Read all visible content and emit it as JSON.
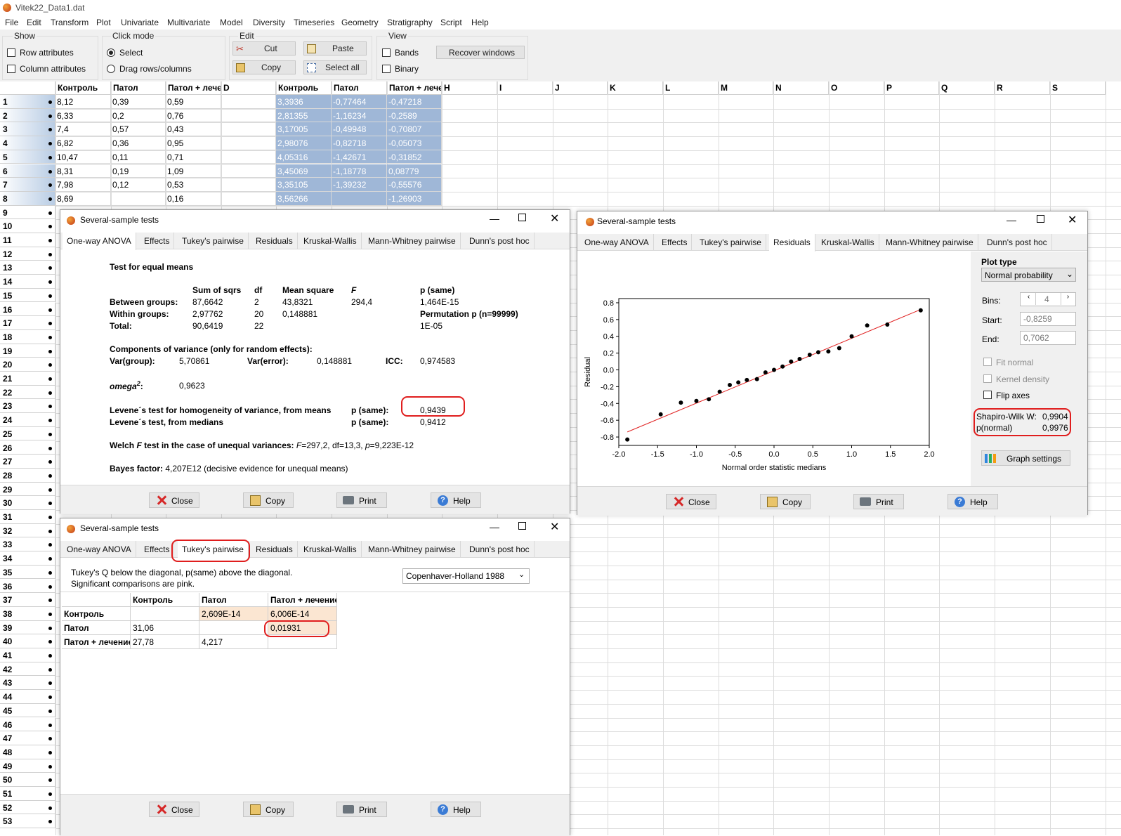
{
  "window_title": "Vitek22_Data1.dat",
  "menu": [
    "File",
    "Edit",
    "Transform",
    "Plot",
    "Univariate",
    "Multivariate",
    "Model",
    "Diversity",
    "Timeseries",
    "Geometry",
    "Stratigraphy",
    "Script",
    "Help"
  ],
  "toolbar": {
    "show_label": "Show",
    "row_attributes": "Row attributes",
    "column_attributes": "Column attributes",
    "click_mode_label": "Click mode",
    "select": "Select",
    "drag": "Drag rows/columns",
    "edit_label": "Edit",
    "cut": "Cut",
    "copy": "Copy",
    "paste": "Paste",
    "select_all": "Select all",
    "view_label": "View",
    "bands": "Bands",
    "binary": "Binary",
    "recover": "Recover windows"
  },
  "sheet": {
    "columns": [
      "Контроль",
      "Патол",
      "Патол + лече",
      "D",
      "Контроль",
      "Патол",
      "Патол + лече",
      "H",
      "I",
      "J",
      "K",
      "L",
      "M",
      "N",
      "O",
      "P",
      "Q",
      "R",
      "S"
    ],
    "rows": [
      [
        "8,12",
        "0,39",
        "0,59",
        "",
        "3,3936",
        "-0,77464",
        "-0,47218"
      ],
      [
        "6,33",
        "0,2",
        "0,76",
        "",
        "2,81355",
        "-1,16234",
        "-0,2589"
      ],
      [
        "7,4",
        "0,57",
        "0,43",
        "",
        "3,17005",
        "-0,49948",
        "-0,70807"
      ],
      [
        "6,82",
        "0,36",
        "0,95",
        "",
        "2,98076",
        "-0,82718",
        "-0,05073"
      ],
      [
        "10,47",
        "0,11",
        "0,71",
        "",
        "4,05316",
        "-1,42671",
        "-0,31852"
      ],
      [
        "8,31",
        "0,19",
        "1,09",
        "",
        "3,45069",
        "-1,18778",
        "0,08779"
      ],
      [
        "7,98",
        "0,12",
        "0,53",
        "",
        "3,35105",
        "-1,39232",
        "-0,55576"
      ],
      [
        "8,69",
        "",
        "0,16",
        "",
        "3,56266",
        "",
        "-1,26903"
      ]
    ],
    "row_numbers": [
      "1",
      "2",
      "3",
      "4",
      "5",
      "6",
      "7",
      "8",
      "9",
      "10",
      "11",
      "12",
      "13",
      "14",
      "15",
      "16",
      "17",
      "18",
      "19",
      "20",
      "21",
      "22",
      "23",
      "24",
      "25",
      "26",
      "27",
      "28",
      "29",
      "30",
      "31",
      "32",
      "33",
      "34",
      "35",
      "36",
      "37",
      "38",
      "39",
      "40",
      "41",
      "42",
      "43",
      "44",
      "45",
      "46",
      "47",
      "48",
      "49",
      "50",
      "51",
      "52",
      "53"
    ]
  },
  "dialog_common": {
    "title": "Several-sample tests",
    "tabs": [
      "One-way ANOVA",
      "Effects",
      "Tukey's pairwise",
      "Residuals",
      "Kruskal-Wallis",
      "Mann-Whitney pairwise",
      "Dunn's post hoc"
    ],
    "close": "Close",
    "copy": "Copy",
    "print": "Print",
    "help": "Help"
  },
  "anova": {
    "heading": "Test for equal means",
    "col_sum": "Sum of sqrs",
    "col_df": "df",
    "col_ms": "Mean square",
    "col_f": "F",
    "col_p": "p (same)",
    "between": "Between groups:",
    "between_ss": "87,6642",
    "between_df": "2",
    "between_ms": "43,8321",
    "between_f": "294,4",
    "between_p": "1,464E-15",
    "within": "Within groups:",
    "within_ss": "2,97762",
    "within_df": "20",
    "within_ms": "0,148881",
    "perm_label": "Permutation p (n=99999)",
    "total": "Total:",
    "total_ss": "90,6419",
    "total_df": "22",
    "perm_p": "1E-05",
    "comp_heading": "Components of variance (only for random effects):",
    "var_group_label": "Var(group):",
    "var_group": "5,70861",
    "var_error_label": "Var(error):",
    "var_error": "0,148881",
    "icc_label": "ICC:",
    "icc": "0,974583",
    "omega_label": "omega",
    "omega_sup": "2",
    "omega_colon": ":",
    "omega": "0,9623",
    "levene_means": "Levene´s test for homogeneity of variance, from means",
    "p_same": "p (same):",
    "levene_means_p": "0,9439",
    "levene_medians": "Levene´s test, from medians",
    "levene_medians_p": "0,9412",
    "welch_a": "Welch ",
    "welch_f": "F",
    "welch_b": " test in the case of unequal variances: ",
    "welch_fv": "F",
    "welch_c": "=297,2, df=13,3, ",
    "welch_p": "p",
    "welch_d": "=9,223E-12",
    "bayes_label": "Bayes factor:",
    "bayes_value": " 4,207E12 (decisive evidence for unequal means)"
  },
  "tukey": {
    "note1": "Tukey's Q below the diagonal, p(same) above the diagonal.",
    "note2": "Significant comparisons are pink.",
    "method": "Copenhaver-Holland 1988",
    "headers": [
      "",
      "Контроль",
      "Патол",
      "Патол + лечение"
    ],
    "rows": [
      [
        "Контроль",
        "",
        "2,609E-14",
        "6,006E-14"
      ],
      [
        "Патол",
        "31,06",
        "",
        "0,01931"
      ],
      [
        "Патол + лечение",
        "27,78",
        "4,217",
        ""
      ]
    ]
  },
  "residuals": {
    "plot_type_label": "Plot type",
    "plot_type": "Normal probability",
    "bins_label": "Bins:",
    "bins": "4",
    "start_label": "Start:",
    "start": "-0,8259",
    "end_label": "End:",
    "end": "0,7062",
    "fit_normal": "Fit normal",
    "kernel_density": "Kernel density",
    "flip_axes": "Flip axes",
    "sw_label": "Shapiro-Wilk W:",
    "sw_value": "0,9904",
    "pn_label": "p(normal)",
    "pn_value": "0,9976",
    "graph_settings": "Graph settings"
  },
  "chart_data": {
    "type": "scatter",
    "xlabel": "Normal order statistic medians",
    "ylabel": "Residual",
    "xlim": [
      -2.0,
      2.0
    ],
    "ylim": [
      -0.9,
      0.85
    ],
    "xticks": [
      "-2.0",
      "-1.5",
      "-1.0",
      "-0.5",
      "0.0",
      "0.5",
      "1.0",
      "1.5",
      "2.0"
    ],
    "yticks": [
      "0.8",
      "0.6",
      "0.4",
      "0.2",
      "0.0",
      "-0.2",
      "-0.4",
      "-0.6",
      "-0.8"
    ],
    "yticks_values": [
      0.8,
      0.6,
      0.4,
      0.2,
      0.0,
      -0.2,
      -0.4,
      -0.6,
      -0.8
    ],
    "xticks_values": [
      -2.0,
      -1.5,
      -1.0,
      -0.5,
      0.0,
      0.5,
      1.0,
      1.5,
      2.0
    ],
    "points": [
      [
        -1.89,
        -0.83
      ],
      [
        -1.46,
        -0.53
      ],
      [
        -1.2,
        -0.39
      ],
      [
        -1.0,
        -0.37
      ],
      [
        -0.84,
        -0.35
      ],
      [
        -0.7,
        -0.26
      ],
      [
        -0.57,
        -0.18
      ],
      [
        -0.46,
        -0.15
      ],
      [
        -0.35,
        -0.12
      ],
      [
        -0.22,
        -0.11
      ],
      [
        -0.11,
        -0.03
      ],
      [
        0.0,
        0.0
      ],
      [
        0.11,
        0.04
      ],
      [
        0.22,
        0.1
      ],
      [
        0.33,
        0.13
      ],
      [
        0.46,
        0.18
      ],
      [
        0.57,
        0.21
      ],
      [
        0.7,
        0.22
      ],
      [
        0.84,
        0.26
      ],
      [
        1.0,
        0.4
      ],
      [
        1.2,
        0.53
      ],
      [
        1.46,
        0.54
      ],
      [
        1.89,
        0.71
      ]
    ],
    "fit_line": [
      [
        -1.89,
        -0.74
      ],
      [
        1.89,
        0.72
      ]
    ],
    "point_color": "#000000",
    "line_color": "#e02020"
  }
}
